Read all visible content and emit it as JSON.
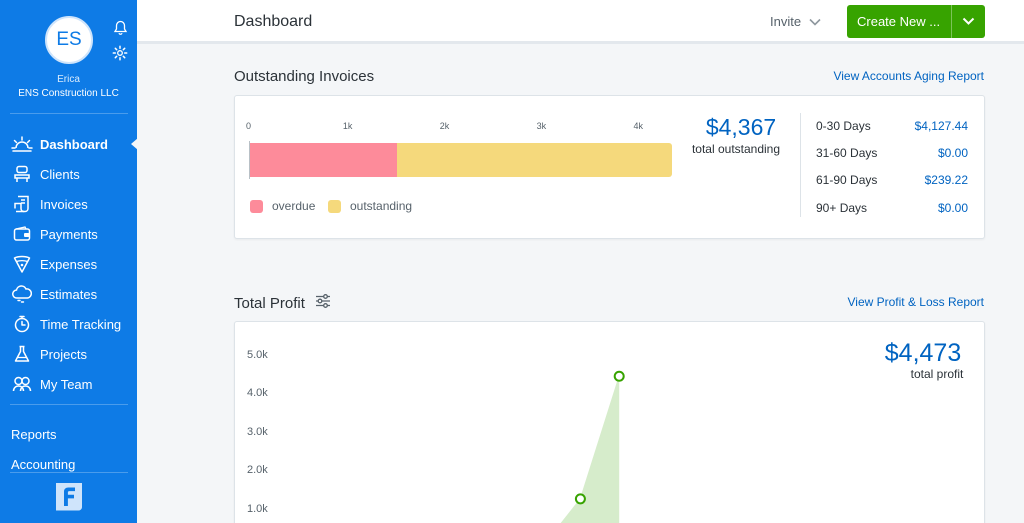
{
  "sidebar": {
    "avatar_initials": "ES",
    "user_name": "Erica",
    "company": "ENS Construction LLC",
    "items": [
      {
        "label": "Dashboard",
        "icon": "dashboard-sun-icon"
      },
      {
        "label": "Clients",
        "icon": "clients-icon"
      },
      {
        "label": "Invoices",
        "icon": "invoices-icon"
      },
      {
        "label": "Payments",
        "icon": "wallet-icon"
      },
      {
        "label": "Expenses",
        "icon": "expenses-icon"
      },
      {
        "label": "Estimates",
        "icon": "estimates-cloud-icon"
      },
      {
        "label": "Time Tracking",
        "icon": "stopwatch-icon"
      },
      {
        "label": "Projects",
        "icon": "flask-icon"
      },
      {
        "label": "My Team",
        "icon": "team-icon"
      }
    ],
    "reports": "Reports",
    "accounting": "Accounting",
    "colors": {
      "background": "#0e7be6"
    }
  },
  "header": {
    "title": "Dashboard",
    "invite": "Invite",
    "create_new": "Create New ...",
    "colors": {
      "primary": "#37a300"
    }
  },
  "invoices": {
    "title": "Outstanding Invoices",
    "link": "View Accounts Aging Report",
    "axis_ticks": [
      {
        "value": 0,
        "label": "0"
      },
      {
        "value": 1000,
        "label": "1k"
      },
      {
        "value": 2000,
        "label": "2k"
      },
      {
        "value": 3000,
        "label": "3k"
      },
      {
        "value": 4000,
        "label": "4k"
      }
    ],
    "bar_max": 4367,
    "overdue": 1528,
    "outstanding": 2839,
    "legend_overdue": "overdue",
    "legend_outstanding": "outstanding",
    "total": "$4,367",
    "total_label": "total outstanding",
    "aging": [
      {
        "label": "0-30 Days",
        "value": "$4,127.44"
      },
      {
        "label": "31-60 Days",
        "value": "$0.00"
      },
      {
        "label": "61-90 Days",
        "value": "$239.22"
      },
      {
        "label": "90+ Days",
        "value": "$0.00"
      }
    ],
    "colors": {
      "overdue": "#fd8b9a",
      "outstanding": "#f5d97c",
      "accent": "#0063c1"
    }
  },
  "profit": {
    "title": "Total Profit",
    "link": "View Profit & Loss Report",
    "total": "$4,473",
    "total_label": "total profit",
    "y_ticks": [
      {
        "value": 1000,
        "label": "1.0k"
      },
      {
        "value": 2000,
        "label": "2.0k"
      },
      {
        "value": 3000,
        "label": "3.0k"
      },
      {
        "value": 4000,
        "label": "4.0k"
      },
      {
        "value": 5000,
        "label": "5.0k"
      }
    ],
    "colors": {
      "line": "#37a300",
      "fill": "#d6eccb"
    }
  },
  "chart_data": {
    "type": "area",
    "title": "",
    "ylim": [
      0,
      5000
    ],
    "series": [
      {
        "name": "",
        "values": [
          0,
          0,
          0,
          0,
          0,
          0,
          0,
          0,
          1280,
          4473
        ]
      }
    ]
  }
}
